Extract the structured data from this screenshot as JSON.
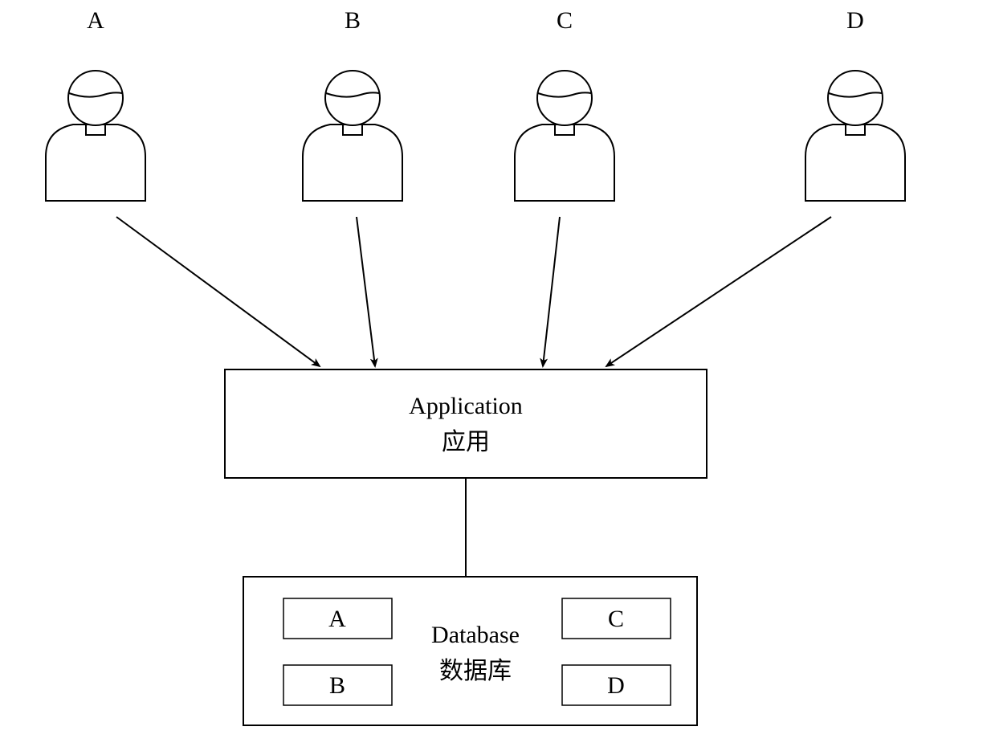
{
  "users": {
    "a": "A",
    "b": "B",
    "c": "C",
    "d": "D"
  },
  "application": {
    "title_en": "Application",
    "title_cn": "应用"
  },
  "database": {
    "title_en": "Database",
    "title_cn": "数据库",
    "cells": {
      "a": "A",
      "b": "B",
      "c": "C",
      "d": "D"
    }
  }
}
